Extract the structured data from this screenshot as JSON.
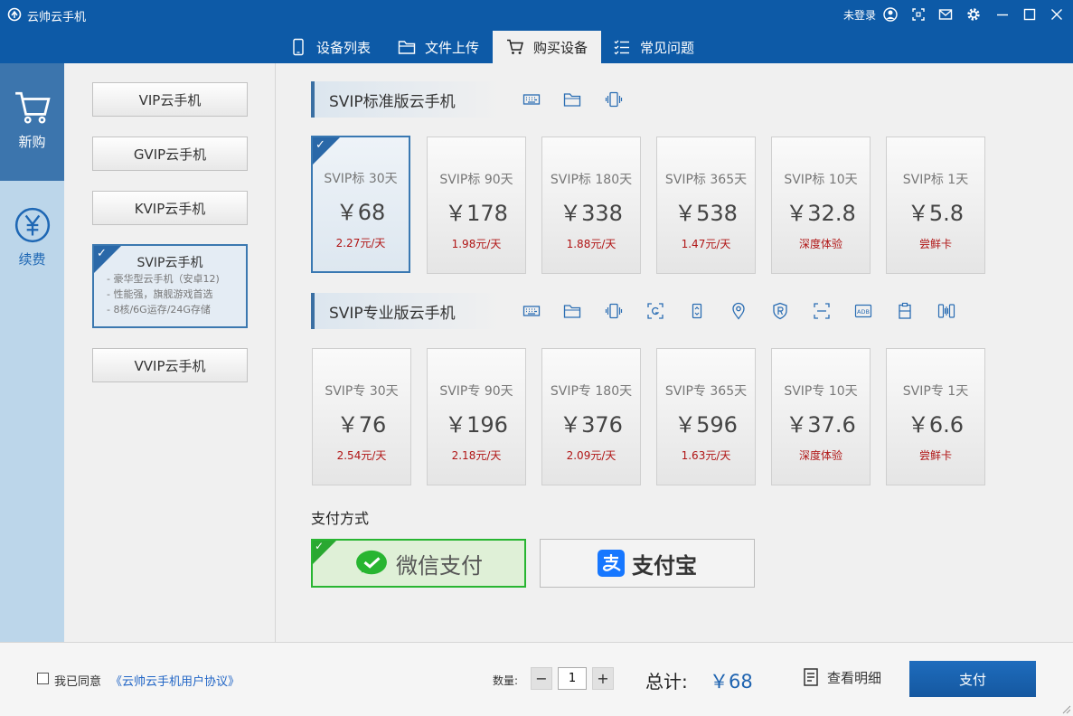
{
  "window": {
    "title": "云帅云手机",
    "login_status": "未登录",
    "icons": [
      "user-icon",
      "fullscreen-icon",
      "mail-icon",
      "settings-icon",
      "minimize-icon",
      "maximize-icon",
      "close-icon"
    ]
  },
  "tabs": [
    {
      "label": "设备列表",
      "icon": "phone-icon",
      "active": false
    },
    {
      "label": "文件上传",
      "icon": "folder-icon",
      "active": false
    },
    {
      "label": "购买设备",
      "icon": "cart-icon",
      "active": true
    },
    {
      "label": "常见问题",
      "icon": "list-icon",
      "active": false
    }
  ],
  "left_nav": [
    {
      "label": "新购",
      "icon": "cart-icon",
      "active": true
    },
    {
      "label": "续费",
      "icon": "yen-icon",
      "active": false
    }
  ],
  "tiers": [
    {
      "label": "VIP云手机"
    },
    {
      "label": "GVIP云手机"
    },
    {
      "label": "KVIP云手机"
    },
    {
      "label": "SVIP云手机",
      "selected": true,
      "features": [
        "- 豪华型云手机（安卓12)",
        "- 性能强，旗舰游戏首选",
        "- 8核/6G运存/24G存储"
      ]
    },
    {
      "label": "VVIP云手机"
    }
  ],
  "sections": {
    "standard": {
      "title": "SVIP标准版云手机",
      "icons": [
        "keyboard-icon",
        "folder-icon",
        "vibrate-icon"
      ],
      "plans": [
        {
          "name": "SVIP标 30天",
          "price": "￥68",
          "sub": "2.27元/天",
          "selected": true
        },
        {
          "name": "SVIP标 90天",
          "price": "￥178",
          "sub": "1.98元/天"
        },
        {
          "name": "SVIP标 180天",
          "price": "￥338",
          "sub": "1.88元/天"
        },
        {
          "name": "SVIP标 365天",
          "price": "￥538",
          "sub": "1.47元/天"
        },
        {
          "name": "SVIP标 10天",
          "price": "￥32.8",
          "sub": "深度体验"
        },
        {
          "name": "SVIP标 1天",
          "price": "￥5.8",
          "sub": "尝鲜卡"
        }
      ]
    },
    "pro": {
      "title": "SVIP专业版云手机",
      "icons": [
        "keyboard-icon",
        "folder-icon",
        "vibrate-icon",
        "screenshot-icon",
        "rotate-icon",
        "location-icon",
        "root-icon",
        "scan-icon",
        "adb-icon",
        "clipboard-icon",
        "sync-icon"
      ],
      "plans": [
        {
          "name": "SVIP专 30天",
          "price": "￥76",
          "sub": "2.54元/天"
        },
        {
          "name": "SVIP专 90天",
          "price": "￥196",
          "sub": "2.18元/天"
        },
        {
          "name": "SVIP专 180天",
          "price": "￥376",
          "sub": "2.09元/天"
        },
        {
          "name": "SVIP专 365天",
          "price": "￥596",
          "sub": "1.63元/天"
        },
        {
          "name": "SVIP专 10天",
          "price": "￥37.6",
          "sub": "深度体验"
        },
        {
          "name": "SVIP专 1天",
          "price": "￥6.6",
          "sub": "尝鲜卡"
        }
      ]
    }
  },
  "payment": {
    "label": "支付方式",
    "options": [
      {
        "label": "微信支付",
        "icon": "wechat-icon",
        "selected": true,
        "color": "#28b531"
      },
      {
        "label": "支付宝",
        "icon": "alipay-icon",
        "selected": false,
        "color": "#1677ff"
      }
    ]
  },
  "footer": {
    "agree_text": "我已同意",
    "agreement_link": "《云帅云手机用户协议》",
    "agree_checked": false,
    "quantity_label": "数量:",
    "minus": "−",
    "plus": "+",
    "quantity": "1",
    "total_label": "总计:",
    "total_value": "￥68",
    "detail_label": "查看明细",
    "pay_label": "支付"
  },
  "colors": {
    "brand": "#0d5aa7",
    "accent": "#3978b2",
    "price_sub": "#b01414"
  }
}
